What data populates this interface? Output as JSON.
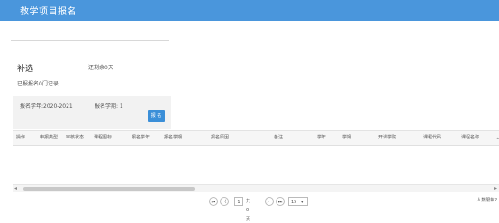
{
  "page": {
    "title": "教学项目报名"
  },
  "section": {
    "title": "补选",
    "note": "还剩余0天",
    "count": "已报报名0门记录"
  },
  "filter": {
    "year_label": "报名学年:2020-2021",
    "term_label": "报名学期: 1",
    "apply_label": "报 名"
  },
  "table": {
    "columns": [
      "操作",
      "申报类型",
      "审核状态",
      "课程图标",
      "报名学年",
      "报名学期",
      "报名原因",
      "备注",
      "学年",
      "学期",
      "开课学院",
      "课程代码",
      "课程名称"
    ],
    "rows": []
  },
  "pagination": {
    "first_label": "⏮",
    "prev_label": "〈",
    "page_value": "1",
    "page_total": "共0页",
    "next_label": "〉",
    "last_label": "⏭",
    "page_size": "15",
    "note": "人数限制?"
  }
}
